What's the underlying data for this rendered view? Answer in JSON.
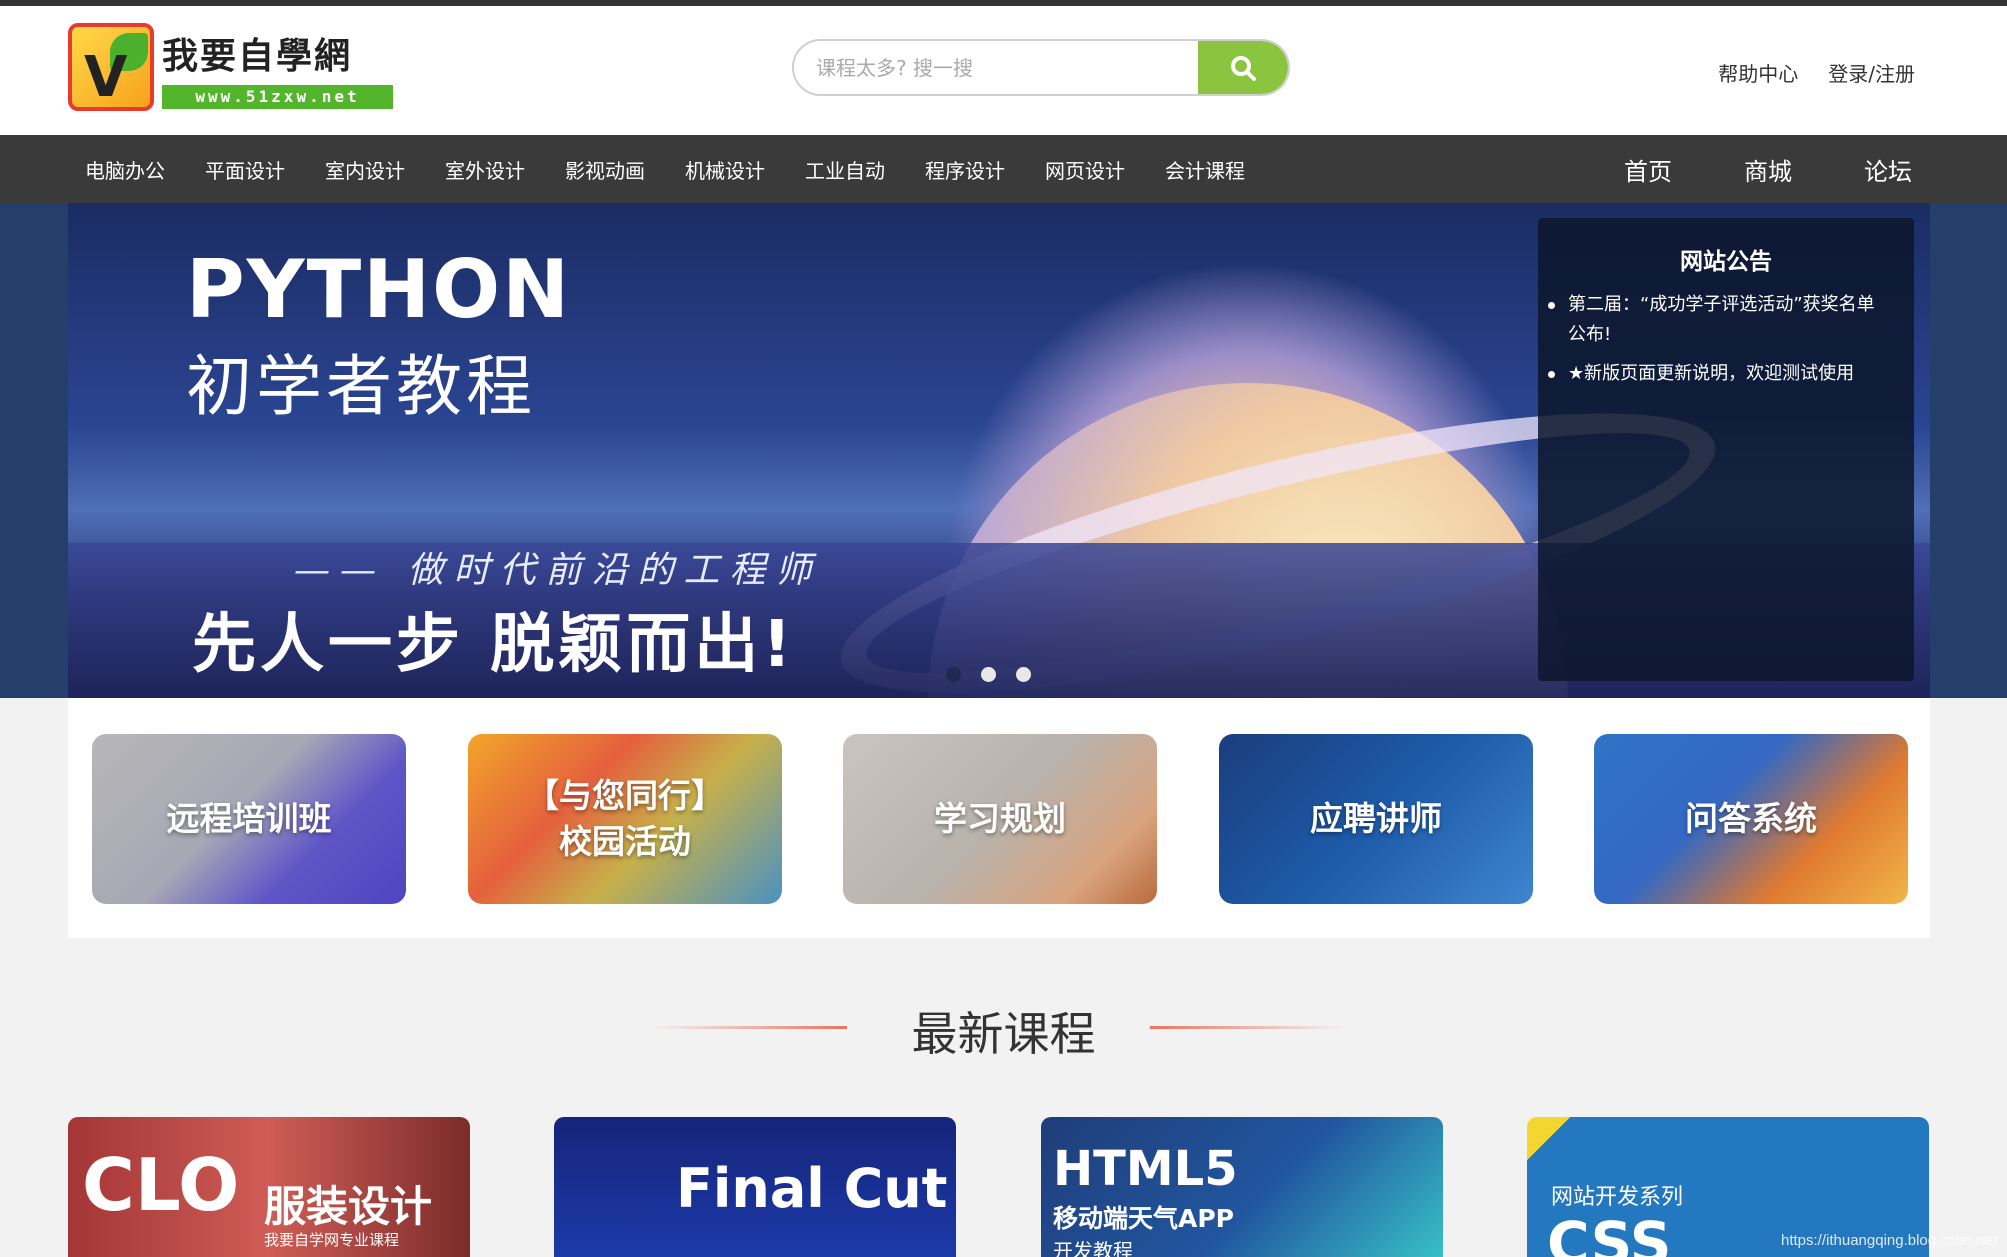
{
  "logo": {
    "title": "我要自學網",
    "url": "www.51zxw.net"
  },
  "search": {
    "placeholder": "课程太多? 搜一搜",
    "icon": "search-icon"
  },
  "top_links": [
    "帮助中心",
    "登录/注册"
  ],
  "categories": [
    "电脑办公",
    "平面设计",
    "室内设计",
    "室外设计",
    "影视动画",
    "机械设计",
    "工业自动",
    "程序设计",
    "网页设计",
    "会计课程"
  ],
  "main_nav": [
    "首页",
    "商城",
    "论坛"
  ],
  "banner": {
    "title": "PYTHON",
    "subtitle": "初学者教程",
    "slogan": "—— 做时代前沿的工程师",
    "slogan2": "先人一步  脱颖而出!",
    "active_dot": 0,
    "dot_count": 3
  },
  "notice": {
    "title": "网站公告",
    "items": [
      "第二届：“成功学子评选活动”获奖名单公布!",
      "★新版页面更新说明，欢迎测试使用"
    ]
  },
  "features": [
    "远程培训班",
    "【与您同行】\n校园活动",
    "学习规划",
    "应聘讲师",
    "问答系统"
  ],
  "section_title": "最新课程",
  "courses": [
    {
      "t1": "CLO",
      "t2": "服装设计",
      "t3": "我要自学网专业课程"
    },
    {
      "t1": "Final Cut"
    },
    {
      "t1": "HTML5",
      "t2": "移动端天气APP",
      "t3": "开发教程"
    },
    {
      "t1": "网站开发系列",
      "t2": "CSS"
    }
  ],
  "watermark": "https://ithuangqing.blog.csdn.net",
  "colors": {
    "nav_bg": "#3a3a3a",
    "accent_green": "#8bc53f",
    "section_line": "#e8765e"
  }
}
